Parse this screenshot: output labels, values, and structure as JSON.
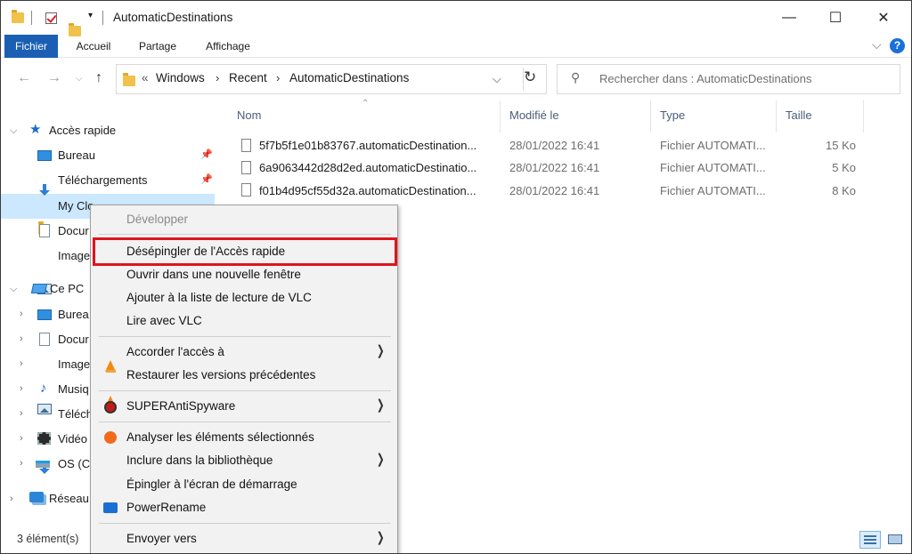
{
  "window": {
    "title": "AutomaticDestinations",
    "controls": {
      "minimize": "—",
      "maximize": "☐",
      "close": "✕"
    }
  },
  "ribbon": {
    "tabs": [
      {
        "label": "Fichier",
        "active": true
      },
      {
        "label": "Accueil"
      },
      {
        "label": "Partage"
      },
      {
        "label": "Affichage"
      }
    ],
    "expand_glyph": "⌵",
    "help": "?"
  },
  "address": {
    "overflow": "«",
    "crumbs": [
      "Windows",
      "Recent",
      "AutomaticDestinations"
    ],
    "dropdown_glyph": "⌵",
    "refresh_glyph": "↻"
  },
  "search": {
    "placeholder": "Rechercher dans : AutomaticDestinations",
    "icon": "search-icon"
  },
  "nav_pane": {
    "quick_access": "Accès rapide",
    "quick_items": [
      "Bureau",
      "Téléchargements",
      "My Clo",
      "Docur",
      "Image"
    ],
    "this_pc": "Ce PC",
    "pc_items": [
      "Burea",
      "Docur",
      "Image",
      "Musiq",
      "Téléch",
      "Vidéo",
      "OS (C:"
    ],
    "network": "Réseau"
  },
  "columns": {
    "name": "Nom",
    "modified": "Modifié le",
    "type": "Type",
    "size": "Taille"
  },
  "files": [
    {
      "name": "5f7b5f1e01b83767.automaticDestination...",
      "modified": "28/01/2022 16:41",
      "type": "Fichier AUTOMATI...",
      "size": "15 Ko"
    },
    {
      "name": "6a9063442d28d2ed.automaticDestinatio...",
      "modified": "28/01/2022 16:41",
      "type": "Fichier AUTOMATI...",
      "size": "5 Ko"
    },
    {
      "name": "f01b4d95cf55d32a.automaticDestination...",
      "modified": "28/01/2022 16:41",
      "type": "Fichier AUTOMATI...",
      "size": "8 Ko"
    }
  ],
  "status": {
    "count": "3 élément(s)"
  },
  "context_menu": {
    "items": [
      {
        "label": "Développer",
        "disabled": true
      },
      {
        "label": "Désépingler de l'Accès rapide",
        "highlighted": true
      },
      {
        "label": "Ouvrir dans une nouvelle fenêtre"
      },
      {
        "label": "Ajouter à la liste de lecture de VLC",
        "icon": "vlc-icon"
      },
      {
        "label": "Lire avec VLC",
        "icon": "vlc-icon"
      },
      {
        "label": "Accorder l'accès à",
        "submenu": true
      },
      {
        "label": "Restaurer les versions précédentes"
      },
      {
        "label": "SUPERAntiSpyware",
        "icon": "superantispyware-icon",
        "submenu": true
      },
      {
        "label": "Analyser les éléments sélectionnés",
        "icon": "avast-icon"
      },
      {
        "label": "Inclure dans la bibliothèque",
        "submenu": true
      },
      {
        "label": "Épingler à l'écran de démarrage"
      },
      {
        "label": "PowerRename",
        "icon": "powerrename-icon"
      },
      {
        "label": "Envoyer vers",
        "submenu": true
      }
    ],
    "submenu_glyph": "❯",
    "highlight_color": "#e0141d"
  },
  "colors": {
    "accent": "#1a5fb4",
    "selection": "#cce8ff",
    "menu_bg": "#f2f2f2"
  }
}
